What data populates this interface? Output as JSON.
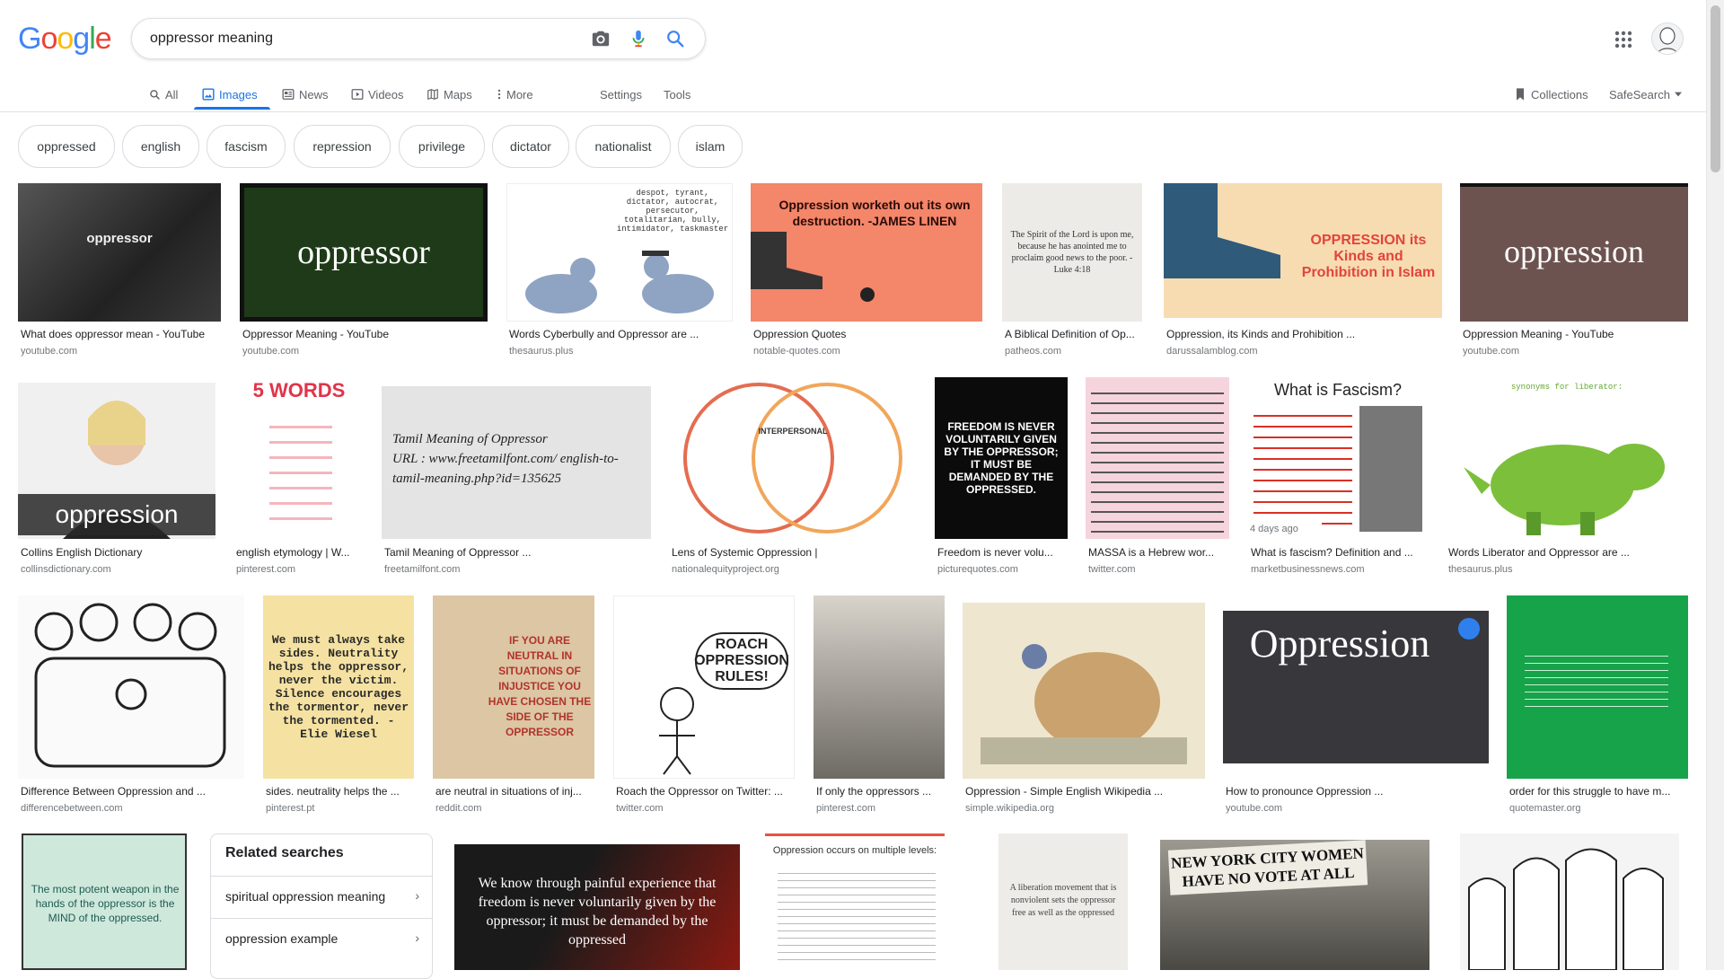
{
  "logo": {
    "letters": [
      "G",
      "o",
      "o",
      "g",
      "l",
      "e"
    ],
    "colors": [
      "#4285f4",
      "#ea4335",
      "#fbbc05",
      "#4285f4",
      "#34a853",
      "#ea4335"
    ]
  },
  "search": {
    "query": "oppressor meaning"
  },
  "colors": {
    "accent": "#1a73e8"
  },
  "tabs": [
    {
      "label": "All",
      "icon": "search-icon"
    },
    {
      "label": "Images",
      "icon": "image-icon",
      "active": true
    },
    {
      "label": "News",
      "icon": "news-icon"
    },
    {
      "label": "Videos",
      "icon": "video-icon"
    },
    {
      "label": "Maps",
      "icon": "map-icon"
    },
    {
      "label": "More",
      "icon": "more-icon"
    },
    {
      "label": "Settings"
    },
    {
      "label": "Tools"
    }
  ],
  "right_nav": {
    "collections": "Collections",
    "safesearch": "SafeSearch"
  },
  "chips": [
    "oppressed",
    "english",
    "fascism",
    "repression",
    "privilege",
    "dictator",
    "nationalist",
    "islam"
  ],
  "results": [
    {
      "caption": "What does oppressor mean - YouTube",
      "source": "youtube.com",
      "thumb_text": "oppressor"
    },
    {
      "caption": "Oppressor Meaning - YouTube",
      "source": "youtube.com",
      "thumb_text": "oppressor"
    },
    {
      "caption": "Words Cyberbully and Oppressor are ...",
      "source": "thesaurus.plus",
      "thumb_text": "despot, tyrant, dictator, autocrat, persecutor, totalitarian, bully, intimidator, taskmaster"
    },
    {
      "caption": "Oppression Quotes",
      "source": "notable-quotes.com",
      "thumb_text": "Oppression worketh out its own destruction. -JAMES LINEN"
    },
    {
      "caption": "A Biblical Definition of Op...",
      "source": "patheos.com",
      "thumb_text": "The Spirit of the Lord is upon me, because he has anointed me to proclaim good news to the poor. - Luke 4:18"
    },
    {
      "caption": "Oppression, its Kinds and Prohibition ...",
      "source": "darussalamblog.com",
      "thumb_text": "OPPRESSION its Kinds and Prohibition in Islam"
    },
    {
      "caption": "Oppression Meaning - YouTube",
      "source": "youtube.com",
      "thumb_text": "oppression"
    },
    {
      "caption": "Collins English Dictionary",
      "source": "collinsdictionary.com",
      "thumb_text": "oppression"
    },
    {
      "caption": "english etymology | W...",
      "source": "pinterest.com",
      "thumb_text": "5 WORDS"
    },
    {
      "caption": "Tamil Meaning of Oppressor ...",
      "source": "freetamilfont.com",
      "thumb_text": "Tamil Meaning of Oppressor\nURL : www.freetamilfont.com/ english-to-tamil-meaning.php?id=135625"
    },
    {
      "caption": "Lens of Systemic Oppression |",
      "source": "nationalequityproject.org",
      "thumb_text": "INTERPERSONAL"
    },
    {
      "caption": "Freedom is never volu...",
      "source": "picturequotes.com",
      "thumb_text": "FREEDOM IS NEVER VOLUNTARILY GIVEN BY THE OPPRESSOR; IT MUST BE DEMANDED BY THE OPPRESSED."
    },
    {
      "caption": "MASSA is a Hebrew wor...",
      "source": "twitter.com",
      "thumb_text": ""
    },
    {
      "caption": "What is fascism? Definition and ...",
      "source": "marketbusinessnews.com",
      "thumb_text": "What is Fascism?",
      "age": "4 days ago"
    },
    {
      "caption": "Words Liberator and Oppressor are ...",
      "source": "thesaurus.plus",
      "thumb_text": "synonyms for liberator:"
    },
    {
      "caption": "Difference Between Oppression and ...",
      "source": "differencebetween.com",
      "thumb_text": ""
    },
    {
      "caption": "sides. neutrality helps the ...",
      "source": "pinterest.pt",
      "thumb_text": "We must always take sides. Neutrality helps the oppressor, never the victim. Silence encourages the tormentor, never the tormented. - Elie Wiesel"
    },
    {
      "caption": "are neutral in situations of inj...",
      "source": "reddit.com",
      "thumb_text": "IF YOU ARE NEUTRAL IN SITUATIONS OF INJUSTICE YOU HAVE CHOSEN THE SIDE OF THE OPPRESSOR"
    },
    {
      "caption": "Roach the Oppressor on Twitter: ...",
      "source": "twitter.com",
      "thumb_text": "ROACH OPPRESSION RULES!"
    },
    {
      "caption": "If only the oppressors ...",
      "source": "pinterest.com",
      "thumb_text": ""
    },
    {
      "caption": "Oppression - Simple English Wikipedia ...",
      "source": "simple.wikipedia.org",
      "thumb_text": ""
    },
    {
      "caption": "How to pronounce Oppression ...",
      "source": "youtube.com",
      "thumb_text": "Oppression"
    },
    {
      "caption": "order for this struggle to have m...",
      "source": "quotemaster.org",
      "thumb_text": ""
    }
  ],
  "bottom_thumbs": [
    {
      "thumb_text": "The most potent weapon in the hands of the oppressor is the MIND of the oppressed."
    },
    {
      "thumb_text": "We know through painful experience that freedom is never voluntarily given by the oppressor; it must be demanded by the oppressed"
    },
    {
      "thumb_text": "Oppression occurs on multiple levels:"
    },
    {
      "thumb_text": "A liberation movement that is nonviolent sets the oppressor free as well as the oppressed"
    },
    {
      "thumb_text": "NEW YORK CITY WOMEN HAVE NO VOTE AT ALL"
    },
    {
      "thumb_text": ""
    }
  ],
  "related": {
    "title": "Related searches",
    "items": [
      "spiritual oppression meaning",
      "oppression example"
    ]
  }
}
